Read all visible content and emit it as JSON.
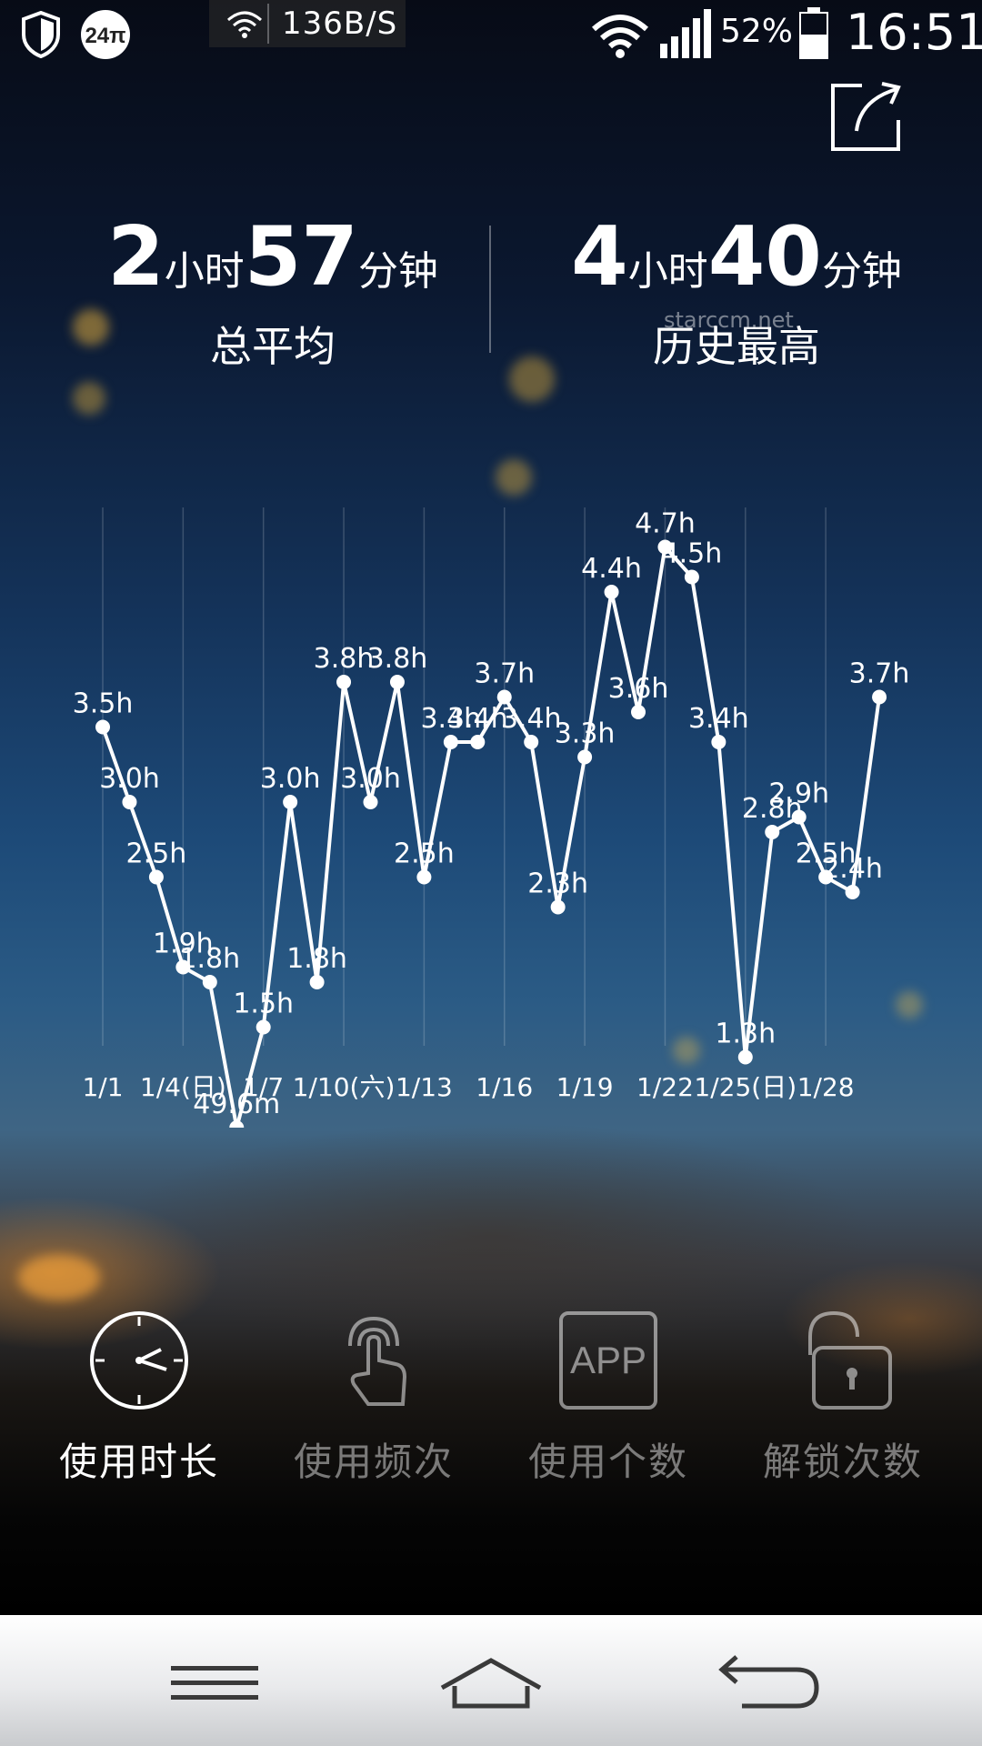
{
  "status_bar": {
    "net_speed": "136B/S",
    "battery": "52%",
    "time": "16:51",
    "left_icons": [
      "shield-icon",
      "24-badge-icon"
    ]
  },
  "stats": {
    "average": {
      "hours": "2",
      "hours_unit": "小时",
      "minutes": "57",
      "minutes_unit": "分钟",
      "caption": "总平均"
    },
    "highest": {
      "hours": "4",
      "hours_unit": "小时",
      "minutes": "40",
      "minutes_unit": "分钟",
      "caption": "历史最高"
    }
  },
  "watermark": "starccm.net",
  "chart_data": {
    "type": "line",
    "x_tick_labels": [
      "1/1",
      "1/4(日)",
      "1/7",
      "1/10(六)",
      "1/13",
      "1/16",
      "1/19",
      "1/22",
      "1/25(日)",
      "1/28"
    ],
    "x": [
      1,
      2,
      3,
      4,
      5,
      6,
      7,
      8,
      9,
      10,
      11,
      12,
      13,
      14,
      15,
      16,
      17,
      18,
      19,
      20,
      21,
      22,
      23,
      24,
      25,
      26,
      27,
      28,
      29
    ],
    "values": [
      3.5,
      3.0,
      2.5,
      1.9,
      1.8,
      0.83,
      1.5,
      3.0,
      1.8,
      3.8,
      3.0,
      3.8,
      2.5,
      3.4,
      3.4,
      3.7,
      3.4,
      2.3,
      3.3,
      4.4,
      3.6,
      4.7,
      4.5,
      3.4,
      1.3,
      2.8,
      2.9,
      2.5,
      2.4,
      3.7
    ],
    "point_labels": [
      "3.5h",
      "3.0h",
      "2.5h",
      "1.9h",
      "1.8h",
      "49.6m",
      "1.5h",
      "3.0h",
      "1.8h",
      "3.8h",
      "3.0h",
      "3.8h",
      "2.5h",
      "3.4h",
      "3.4h",
      "3.7h",
      "3.4h",
      "2.3h",
      "3.3h",
      "4.4h",
      "3.6h",
      "4.7h",
      "4.5h",
      "3.4h",
      "1.3h",
      "2.8h",
      "2.9h",
      "2.5h",
      "2.4h",
      "3.7h"
    ],
    "ylabel": "",
    "xlabel": "",
    "grid": true,
    "color": "#ffffff"
  },
  "tabs": [
    {
      "label": "使用时长",
      "icon": "clock-icon",
      "active": true
    },
    {
      "label": "使用频次",
      "icon": "touch-icon",
      "active": false
    },
    {
      "label": "使用个数",
      "icon": "app-icon",
      "app_text": "APP",
      "active": false
    },
    {
      "label": "解锁次数",
      "icon": "unlock-icon",
      "active": false
    }
  ],
  "nav": {
    "menu_icon": "menu-icon",
    "home_icon": "home-icon",
    "back_icon": "back-icon"
  }
}
